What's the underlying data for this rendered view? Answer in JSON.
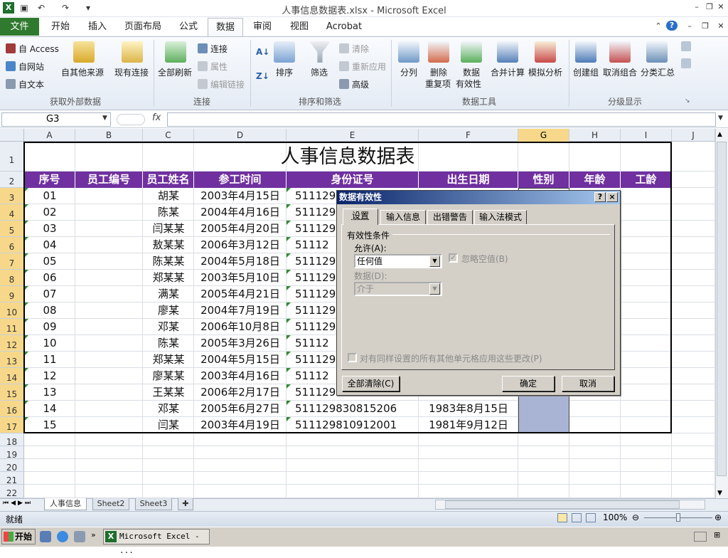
{
  "window": {
    "title": "人事信息数据表.xlsx  -  Microsoft Excel"
  },
  "ribbon_tabs": [
    "文件",
    "开始",
    "插入",
    "页面布局",
    "公式",
    "数据",
    "审阅",
    "视图",
    "Acrobat"
  ],
  "ribbon": {
    "ext_access": "自 Access",
    "ext_web": "自网站",
    "ext_text": "自文本",
    "ext_other": "自其他来源",
    "existing": "现有连接",
    "refresh_all": "全部刷新",
    "conn": "连接",
    "props": "属性",
    "edit_links": "编辑链接",
    "sort": "排序",
    "filter": "筛选",
    "clear": "清除",
    "reapply": "重新应用",
    "advanced": "高级",
    "text_to_cols": "分列",
    "remove_dup_1": "删除",
    "remove_dup_2": "重复项",
    "validation_1": "数据",
    "validation_2": "有效性",
    "consolidate": "合并计算",
    "whatif": "模拟分析",
    "group": "创建组",
    "ungroup": "取消组合",
    "subtotal": "分类汇总",
    "grp_external": "获取外部数据",
    "grp_connections": "连接",
    "grp_sort": "排序和筛选",
    "grp_tools": "数据工具",
    "grp_outline": "分级显示"
  },
  "formula_bar": {
    "name_box": "G3",
    "fx": "fx",
    "value": ""
  },
  "columns": [
    "A",
    "B",
    "C",
    "D",
    "E",
    "F",
    "G",
    "H",
    "I",
    "J"
  ],
  "rows": [
    "1",
    "2",
    "3",
    "4",
    "5",
    "6",
    "7",
    "8",
    "9",
    "10",
    "11",
    "12",
    "13",
    "14",
    "15",
    "16",
    "17",
    "18",
    "19",
    "20",
    "21",
    "22"
  ],
  "sheet": {
    "title": "人事信息数据表",
    "headers": [
      "序号",
      "员工编号",
      "员工姓名",
      "参工时间",
      "身份证号",
      "出生日期",
      "性别",
      "年龄",
      "工龄"
    ],
    "data": [
      {
        "no": "01",
        "name": "胡某",
        "date": "2003年4月15日",
        "id": "511129",
        "birth": ""
      },
      {
        "no": "02",
        "name": "陈某",
        "date": "2004年4月16日",
        "id": "511129",
        "birth": ""
      },
      {
        "no": "03",
        "name": "闫某某",
        "date": "2005年4月20日",
        "id": "511129",
        "birth": ""
      },
      {
        "no": "04",
        "name": "敖某某",
        "date": "2006年3月12日",
        "id": "51112",
        "birth": ""
      },
      {
        "no": "05",
        "name": "陈某某",
        "date": "2004年5月18日",
        "id": "511129",
        "birth": ""
      },
      {
        "no": "06",
        "name": "郑某某",
        "date": "2003年5月10日",
        "id": "511129",
        "birth": ""
      },
      {
        "no": "07",
        "name": "满某",
        "date": "2005年4月21日",
        "id": "511129",
        "birth": ""
      },
      {
        "no": "08",
        "name": "廖某",
        "date": "2004年7月19日",
        "id": "511129",
        "birth": ""
      },
      {
        "no": "09",
        "name": "邓某",
        "date": "2006年10月8日",
        "id": "511129",
        "birth": ""
      },
      {
        "no": "10",
        "name": "陈某",
        "date": "2005年3月26日",
        "id": "51112",
        "birth": ""
      },
      {
        "no": "11",
        "name": "郑某某",
        "date": "2004年5月15日",
        "id": "511129",
        "birth": ""
      },
      {
        "no": "12",
        "name": "廖某某",
        "date": "2003年4月16日",
        "id": "51112",
        "birth": ""
      },
      {
        "no": "13",
        "name": "王某某",
        "date": "2006年2月17日",
        "id": "511129",
        "birth": ""
      },
      {
        "no": "14",
        "name": "邓某",
        "date": "2005年6月27日",
        "id": "511129830815206",
        "birth": "1983年8月15日"
      },
      {
        "no": "15",
        "name": "闫某",
        "date": "2003年4月19日",
        "id": "511129810912001",
        "birth": "1981年9月12日"
      }
    ]
  },
  "sheet_tabs": [
    "人事信息",
    "Sheet2",
    "Sheet3"
  ],
  "status": {
    "ready": "就绪",
    "zoom": "100%"
  },
  "dialog": {
    "title": "数据有效性",
    "help": "?",
    "close": "×",
    "tabs": [
      "设置",
      "输入信息",
      "出错警告",
      "输入法模式"
    ],
    "section": "有效性条件",
    "allow_label": "允许(A):",
    "allow_value": "任何值",
    "ignore_blank": "忽略空值(B)",
    "data_label": "数据(D):",
    "data_value": "介于",
    "apply_all": "对有同样设置的所有其他单元格应用这些更改(P)",
    "clear_all": "全部清除(C)",
    "ok": "确定",
    "cancel": "取消"
  },
  "taskbar": {
    "start": "开始",
    "app": "Microsoft Excel - ..."
  },
  "colors": {
    "header_purple": "#7030a0",
    "file_green": "#2f7a2f",
    "selection": "#a9b4d4"
  }
}
